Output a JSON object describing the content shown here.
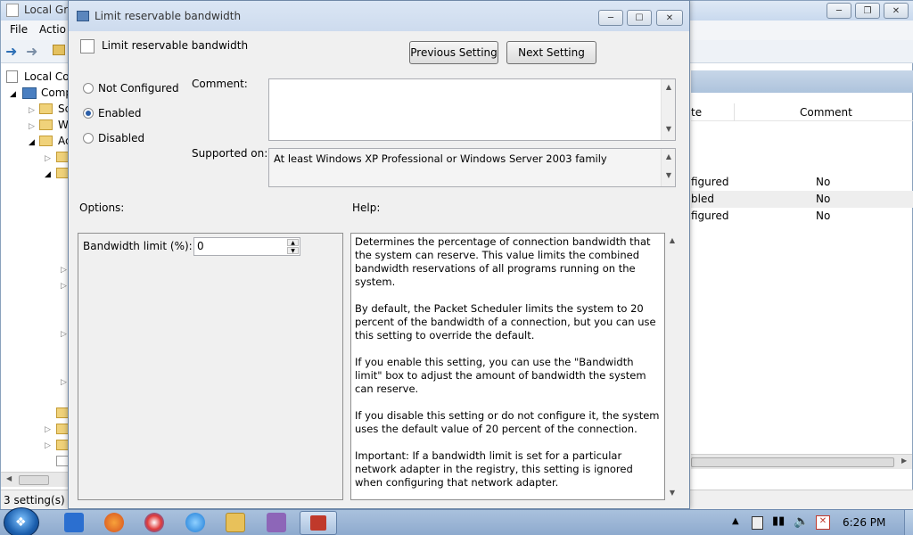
{
  "background_window": {
    "title": "Local Gro",
    "menu": [
      "File",
      "Actio"
    ],
    "tree": [
      "Local Co",
      "Comp",
      "Sc",
      "W",
      "Ac"
    ],
    "columns": {
      "state": "te",
      "comment": "Comment"
    },
    "rows": [
      {
        "state": "figured",
        "comment": "No"
      },
      {
        "state": "bled",
        "comment": "No"
      },
      {
        "state": "figured",
        "comment": "No"
      }
    ],
    "status": "3 setting(s)"
  },
  "dialog": {
    "window_title": "Limit reservable bandwidth",
    "setting_title": "Limit reservable bandwidth",
    "previous_label": "Previous Setting",
    "next_label": "Next Setting",
    "radio": {
      "not_configured": "Not Configured",
      "enabled": "Enabled",
      "disabled": "Disabled",
      "selected": "enabled"
    },
    "comment_label": "Comment:",
    "comment_value": "",
    "supported_label": "Supported on:",
    "supported_value": "At least Windows XP Professional or Windows Server 2003 family",
    "options_label": "Options:",
    "help_label": "Help:",
    "bandwidth_label": "Bandwidth limit (%):",
    "bandwidth_value": "0",
    "help_paragraphs": [
      "Determines the percentage of connection bandwidth that the system can reserve. This value limits the combined bandwidth reservations of all programs running on the system.",
      "By default, the Packet Scheduler limits the system to 20 percent of the bandwidth of a connection, but you can use this setting to override the default.",
      "If you enable this setting, you can use the \"Bandwidth limit\" box to adjust the amount of bandwidth the system can reserve.",
      "If you disable this setting or do not configure it, the system uses the default value of 20 percent of the connection.",
      "Important: If a bandwidth limit is set for a particular network adapter in the registry, this setting is ignored when configuring that network adapter."
    ]
  },
  "taskbar": {
    "clock": "6:26 PM",
    "apps": [
      "metro-app-icon",
      "firefox-icon",
      "sync-icon",
      "internet-explorer-icon",
      "file-explorer-icon",
      "visual-studio-icon",
      "group-policy-icon"
    ]
  },
  "colors": {
    "selection": "#2a5ea8",
    "listhead": "#adc3dc",
    "taskbar": "#8eaace"
  }
}
